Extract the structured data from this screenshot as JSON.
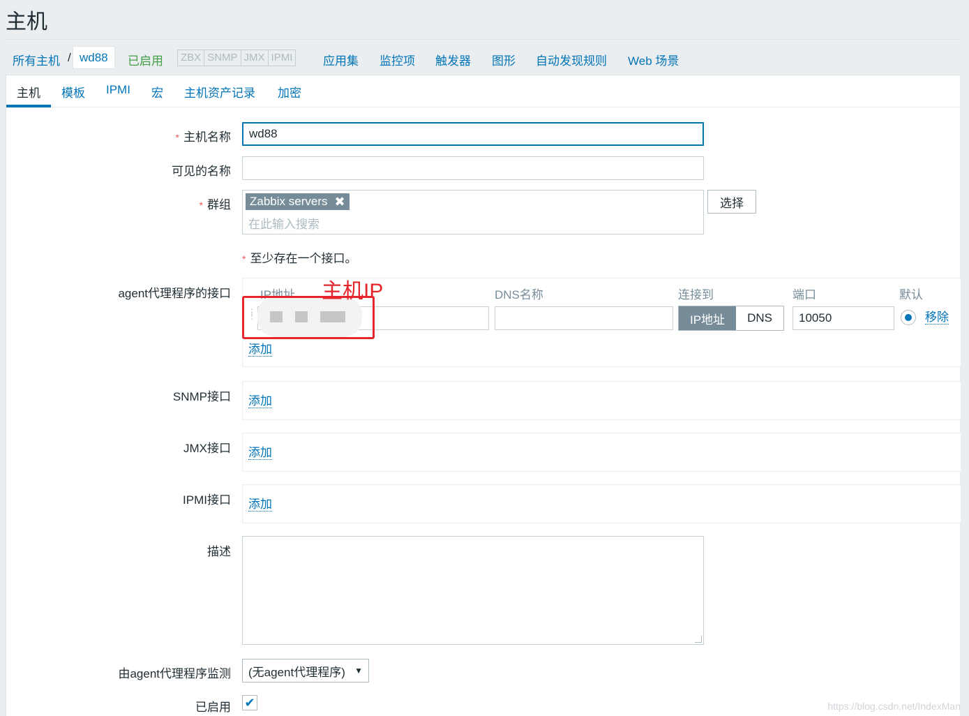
{
  "page": {
    "title": "主机"
  },
  "breadcrumb": {
    "all_hosts": "所有主机",
    "separator": "/",
    "current": "wd88",
    "status": "已启用",
    "availability": [
      "ZBX",
      "SNMP",
      "JMX",
      "IPMI"
    ],
    "links": [
      "应用集",
      "监控项",
      "触发器",
      "图形",
      "自动发现规则",
      "Web 场景"
    ]
  },
  "tabs": [
    "主机",
    "模板",
    "IPMI",
    "宏",
    "主机资产记录",
    "加密"
  ],
  "form": {
    "hostname": {
      "label": "主机名称",
      "value": "wd88"
    },
    "visible_name": {
      "label": "可见的名称",
      "value": ""
    },
    "groups": {
      "label": "群组",
      "selected": [
        "Zabbix servers"
      ],
      "placeholder": "在此输入搜索",
      "select_button": "选择"
    },
    "interfaces_hint": "至少存在一个接口。",
    "agent_interface": {
      "label": "agent代理程序的接口",
      "columns": {
        "ip": "IP地址",
        "dns": "DNS名称",
        "connect": "连接到",
        "port": "端口",
        "default": "默认"
      },
      "connect_options": [
        "IP地址",
        "DNS"
      ],
      "connect_selected": "IP地址",
      "dns_value": "",
      "port": "10050",
      "remove": "移除",
      "add": "添加"
    },
    "snmp_interface": {
      "label": "SNMP接口",
      "add": "添加"
    },
    "jmx_interface": {
      "label": "JMX接口",
      "add": "添加"
    },
    "ipmi_interface": {
      "label": "IPMI接口",
      "add": "添加"
    },
    "description": {
      "label": "描述",
      "value": ""
    },
    "proxy": {
      "label": "由agent代理程序监测",
      "selected": "(无agent代理程序)"
    },
    "enabled": {
      "label": "已启用",
      "checked": true
    }
  },
  "annotation": {
    "text": "主机IP",
    "color": "#e5262d"
  },
  "watermark": "https://blog.csdn.net/IndexMan",
  "colors": {
    "link": "#0275b8",
    "enabled": "#429e47",
    "required": "#e45959",
    "chip": "#768d99"
  }
}
